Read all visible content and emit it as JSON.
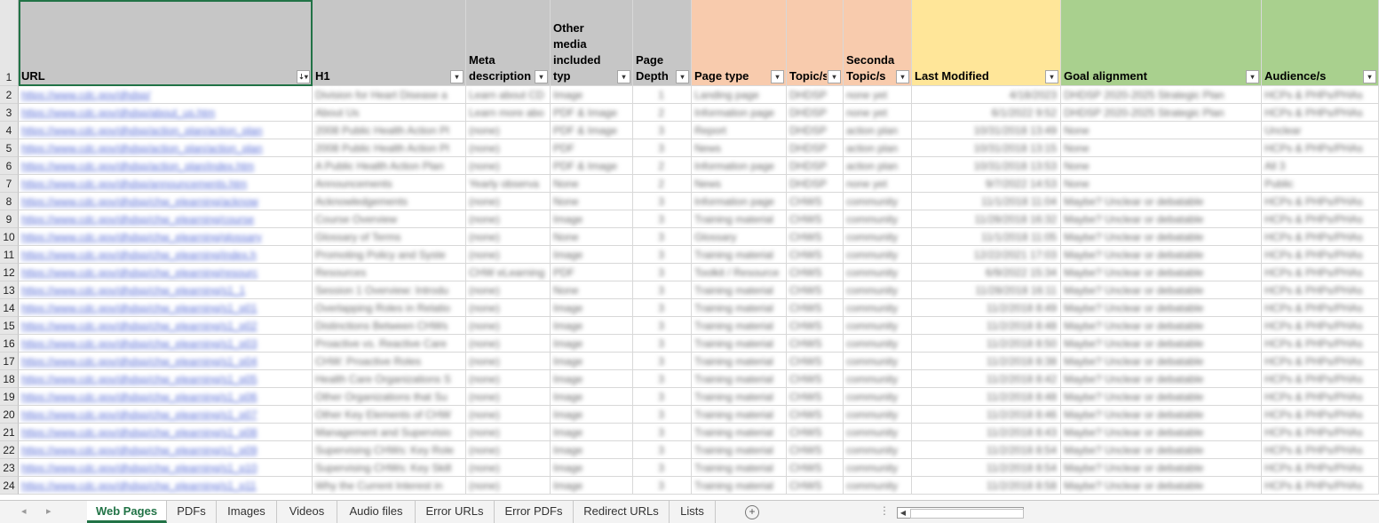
{
  "headers": [
    {
      "label": "URL",
      "bg": "#c6c6c6",
      "filter": "⇣▾",
      "sorted": true
    },
    {
      "label": "H1",
      "bg": "#c6c6c6",
      "filter": "▾"
    },
    {
      "label": "Meta description",
      "bg": "#c6c6c6",
      "filter": "▾"
    },
    {
      "label": "Other media included typ",
      "bg": "#c6c6c6",
      "filter": "▾"
    },
    {
      "label": "Page Depth",
      "bg": "#c6c6c6",
      "filter": "▾"
    },
    {
      "label": "Page type",
      "bg": "#f8cbad",
      "filter": "▾"
    },
    {
      "label": "Topic/s",
      "bg": "#f8cbad",
      "filter": "▾"
    },
    {
      "label": "Secondary Topic/s",
      "bg": "#f8cbad",
      "filter": "▾"
    },
    {
      "label": "Last Modified",
      "bg": "#ffe699",
      "filter": "▾"
    },
    {
      "label": "Goal alignment",
      "bg": "#a9d08e",
      "filter": "▾"
    },
    {
      "label": "Audience/s",
      "bg": "#a9d08e",
      "filter": "▾"
    }
  ],
  "rows": [
    {
      "num": "2",
      "cells": [
        "https://www.cdc.gov/dhdsp/",
        "Division for Heart Disease a",
        "Learn about CD",
        "Image",
        "1",
        "Landing page",
        "DHDSP",
        "none yet",
        "4/18/2023",
        "DHDSP 2020-2025 Strategic Plan",
        "HCPs & PHPs/PHAs"
      ]
    },
    {
      "num": "3",
      "cells": [
        "https://www.cdc.gov/dhdsp/about_us.htm",
        "About Us",
        "Learn more abo",
        "PDF & Image",
        "2",
        "Information page",
        "DHDSP",
        "none yet",
        "6/1/2022 9:52",
        "DHDSP 2020-2025 Strategic Plan",
        "HCPs & PHPs/PHAs"
      ]
    },
    {
      "num": "4",
      "cells": [
        "https://www.cdc.gov/dhdsp/action_plan/action_plan",
        "2008 Public Health Action Pl",
        "(none)",
        "PDF & Image",
        "3",
        "Report",
        "DHDSP",
        "action plan",
        "10/31/2018 13:49",
        "None",
        "Unclear"
      ]
    },
    {
      "num": "5",
      "cells": [
        "https://www.cdc.gov/dhdsp/action_plan/action_plan",
        "2008 Public Health Action Pl",
        "(none)",
        "PDF",
        "3",
        "News",
        "DHDSP",
        "action plan",
        "10/31/2018 13:15",
        "None",
        "HCPs & PHPs/PHAs"
      ]
    },
    {
      "num": "6",
      "cells": [
        "https://www.cdc.gov/dhdsp/action_plan/index.htm",
        "A Public Health Action Plan",
        "(none)",
        "PDF & Image",
        "2",
        "Information page",
        "DHDSP",
        "action plan",
        "10/31/2018 13:53",
        "None",
        "All 3"
      ]
    },
    {
      "num": "7",
      "cells": [
        "https://www.cdc.gov/dhdsp/announcements.htm",
        "Announcements",
        "Yearly observa",
        "None",
        "2",
        "News",
        "DHDSP",
        "none yet",
        "9/7/2022 14:53",
        "None",
        "Public"
      ]
    },
    {
      "num": "8",
      "cells": [
        "https://www.cdc.gov/dhdsp/chw_elearning/acknow",
        "Acknowledgements",
        "(none)",
        "None",
        "3",
        "Information page",
        "CHWS",
        "community",
        "11/1/2018 11:04",
        "Maybe? Unclear or debatable",
        "HCPs & PHPs/PHAs"
      ]
    },
    {
      "num": "9",
      "cells": [
        "https://www.cdc.gov/dhdsp/chw_elearning/course",
        "Course Overview",
        "(none)",
        "Image",
        "3",
        "Training material",
        "CHWS",
        "community",
        "11/28/2018 16:32",
        "Maybe? Unclear or debatable",
        "HCPs & PHPs/PHAs"
      ]
    },
    {
      "num": "10",
      "cells": [
        "https://www.cdc.gov/dhdsp/chw_elearning/glossary",
        "Glossary of Terms",
        "(none)",
        "None",
        "3",
        "Glossary",
        "CHWS",
        "community",
        "11/1/2018 11:05",
        "Maybe? Unclear or debatable",
        "HCPs & PHPs/PHAs"
      ]
    },
    {
      "num": "11",
      "cells": [
        "https://www.cdc.gov/dhdsp/chw_elearning/index.h",
        "Promoting Policy and Syste",
        "(none)",
        "Image",
        "3",
        "Training material",
        "CHWS",
        "community",
        "12/22/2021 17:03",
        "Maybe? Unclear or debatable",
        "HCPs & PHPs/PHAs"
      ]
    },
    {
      "num": "12",
      "cells": [
        "https://www.cdc.gov/dhdsp/chw_elearning/resourc",
        "Resources",
        "CHW eLearning",
        "PDF",
        "3",
        "Toolkit / Resource",
        "CHWS",
        "community",
        "6/9/2022 15:34",
        "Maybe? Unclear or debatable",
        "HCPs & PHPs/PHAs"
      ]
    },
    {
      "num": "13",
      "cells": [
        "https://www.cdc.gov/dhdsp/chw_elearning/s1_1",
        "Session 1 Overview: Introdu",
        "(none)",
        "None",
        "3",
        "Training material",
        "CHWS",
        "community",
        "11/28/2018 16:11",
        "Maybe? Unclear or debatable",
        "HCPs & PHPs/PHAs"
      ]
    },
    {
      "num": "14",
      "cells": [
        "https://www.cdc.gov/dhdsp/chw_elearning/s1_p01",
        "Overlapping Roles in Relatio",
        "(none)",
        "Image",
        "3",
        "Training material",
        "CHWS",
        "community",
        "11/2/2018 8:49",
        "Maybe? Unclear or debatable",
        "HCPs & PHPs/PHAs"
      ]
    },
    {
      "num": "15",
      "cells": [
        "https://www.cdc.gov/dhdsp/chw_elearning/s1_p02",
        "Distinctions Between CHWs",
        "(none)",
        "Image",
        "3",
        "Training material",
        "CHWS",
        "community",
        "11/2/2018 8:48",
        "Maybe? Unclear or debatable",
        "HCPs & PHPs/PHAs"
      ]
    },
    {
      "num": "16",
      "cells": [
        "https://www.cdc.gov/dhdsp/chw_elearning/s1_p03",
        "Proactive vs. Reactive Care",
        "(none)",
        "Image",
        "3",
        "Training material",
        "CHWS",
        "community",
        "11/2/2018 8:50",
        "Maybe? Unclear or debatable",
        "HCPs & PHPs/PHAs"
      ]
    },
    {
      "num": "17",
      "cells": [
        "https://www.cdc.gov/dhdsp/chw_elearning/s1_p04",
        "CHW: Proactive Roles",
        "(none)",
        "Image",
        "3",
        "Training material",
        "CHWS",
        "community",
        "11/2/2018 8:38",
        "Maybe? Unclear or debatable",
        "HCPs & PHPs/PHAs"
      ]
    },
    {
      "num": "18",
      "cells": [
        "https://www.cdc.gov/dhdsp/chw_elearning/s1_p05",
        "Health Care Organizations S",
        "(none)",
        "Image",
        "3",
        "Training material",
        "CHWS",
        "community",
        "11/2/2018 8:42",
        "Maybe? Unclear or debatable",
        "HCPs & PHPs/PHAs"
      ]
    },
    {
      "num": "19",
      "cells": [
        "https://www.cdc.gov/dhdsp/chw_elearning/s1_p06",
        "Other Organizations that Su",
        "(none)",
        "Image",
        "3",
        "Training material",
        "CHWS",
        "community",
        "11/2/2018 8:48",
        "Maybe? Unclear or debatable",
        "HCPs & PHPs/PHAs"
      ]
    },
    {
      "num": "20",
      "cells": [
        "https://www.cdc.gov/dhdsp/chw_elearning/s1_p07",
        "Other Key Elements of CHW",
        "(none)",
        "Image",
        "3",
        "Training material",
        "CHWS",
        "community",
        "11/2/2018 8:46",
        "Maybe? Unclear or debatable",
        "HCPs & PHPs/PHAs"
      ]
    },
    {
      "num": "21",
      "cells": [
        "https://www.cdc.gov/dhdsp/chw_elearning/s1_p08",
        "Management and Supervisio",
        "(none)",
        "Image",
        "3",
        "Training material",
        "CHWS",
        "community",
        "11/2/2018 8:43",
        "Maybe? Unclear or debatable",
        "HCPs & PHPs/PHAs"
      ]
    },
    {
      "num": "22",
      "cells": [
        "https://www.cdc.gov/dhdsp/chw_elearning/s1_p09",
        "Supervising CHWs: Key Role",
        "(none)",
        "Image",
        "3",
        "Training material",
        "CHWS",
        "community",
        "11/2/2018 8:54",
        "Maybe? Unclear or debatable",
        "HCPs & PHPs/PHAs"
      ]
    },
    {
      "num": "23",
      "cells": [
        "https://www.cdc.gov/dhdsp/chw_elearning/s1_p10",
        "Supervising CHWs: Key Skill",
        "(none)",
        "Image",
        "3",
        "Training material",
        "CHWS",
        "community",
        "11/2/2018 8:54",
        "Maybe? Unclear or debatable",
        "HCPs & PHPs/PHAs"
      ]
    },
    {
      "num": "24",
      "cells": [
        "https://www.cdc.gov/dhdsp/chw_elearning/s1_p11",
        "Why the Current Interest in",
        "(none)",
        "Image",
        "3",
        "Training material",
        "CHWS",
        "community",
        "11/2/2018 8:58",
        "Maybe? Unclear or debatable",
        "HCPs & PHPs/PHAs"
      ]
    }
  ],
  "header_row_num": "1",
  "tabs": [
    "Web Pages",
    "PDFs",
    "Images",
    "Videos",
    "Audio files",
    "Error URLs",
    "Error PDFs",
    "Redirect URLs",
    "Lists"
  ],
  "active_tab": "Web Pages",
  "tabbar": {
    "add_icon": "+",
    "dots": "⋮",
    "prev_arrow": "◂",
    "next_arrow": "▸"
  },
  "colors": {
    "active_tab": "#217346",
    "link": "#5a6fd8",
    "gray_header": "#c6c6c6",
    "orange_header": "#f8cbad",
    "yellow_header": "#ffe699",
    "green_header": "#a9d08e"
  }
}
